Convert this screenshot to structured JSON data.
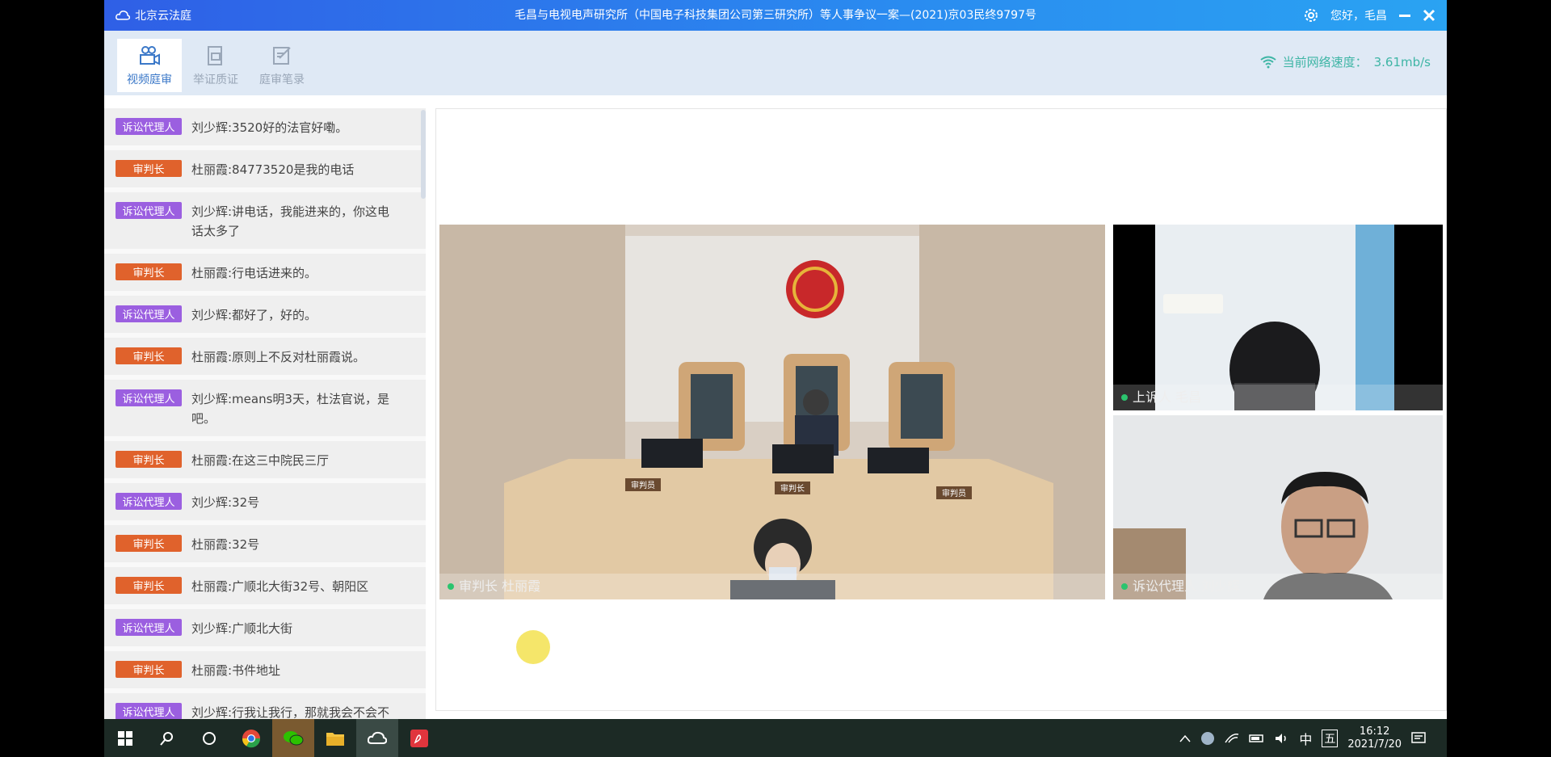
{
  "titlebar": {
    "app_name": "北京云法庭",
    "case_title": "毛昌与电视电声研究所（中国电子科技集团公司第三研究所）等人事争议一案—(2021)京03民终9797号",
    "greeting": "您好，毛昌"
  },
  "tabs": [
    {
      "label": "视频庭审"
    },
    {
      "label": "举证质证"
    },
    {
      "label": "庭审笔录"
    }
  ],
  "network": {
    "label": "当前网络速度：",
    "value": "3.61mb/s"
  },
  "chat": [
    {
      "role": "诉讼代理人",
      "text": "刘少辉:3520好的法官好嘞。"
    },
    {
      "role": "审判长",
      "text": "杜丽霞:84773520是我的电话"
    },
    {
      "role": "诉讼代理人",
      "text": "刘少辉:讲电话，我能进来的，你这电话太多了"
    },
    {
      "role": "审判长",
      "text": "杜丽霞:行电话进来的。"
    },
    {
      "role": "诉讼代理人",
      "text": "刘少辉:都好了，好的。"
    },
    {
      "role": "审判长",
      "text": "杜丽霞:原则上不反对杜丽霞说。"
    },
    {
      "role": "诉讼代理人",
      "text": "刘少辉:means明3天，杜法官说，是吧。"
    },
    {
      "role": "审判长",
      "text": "杜丽霞:在这三中院民三厅"
    },
    {
      "role": "诉讼代理人",
      "text": "刘少辉:32号"
    },
    {
      "role": "审判长",
      "text": "杜丽霞:32号"
    },
    {
      "role": "审判长",
      "text": "杜丽霞:广顺北大街32号、朝阳区"
    },
    {
      "role": "诉讼代理人",
      "text": "刘少辉:广顺北大街"
    },
    {
      "role": "审判长",
      "text": "杜丽霞:书件地址"
    },
    {
      "role": "诉讼代理人",
      "text": "刘少辉:行我让我行，那就我会不会不"
    }
  ],
  "videos": {
    "main": {
      "label": "审判长 杜丽霞"
    },
    "top_right": {
      "label": "上诉人 毛昌"
    },
    "bottom_right": {
      "label": "诉讼代理人 刘少辉"
    }
  },
  "courtroom_seats": {
    "left": "审判员",
    "center": "审判长",
    "right": "审判员"
  },
  "taskbar": {
    "ime": "中",
    "ime2": "五",
    "time": "16:12",
    "date": "2021/7/20"
  },
  "colors": {
    "lawyer_tag": "#9b5fe0",
    "judge_tag": "#e0622c",
    "title_bar": "#2a8cf0",
    "network_text": "#3eb5a5"
  }
}
